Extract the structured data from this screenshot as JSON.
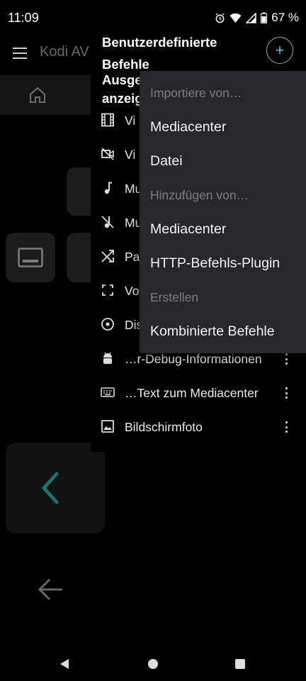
{
  "status_bar": {
    "time": "11:09",
    "battery": "67 %"
  },
  "background_app": {
    "title": "Kodi AV"
  },
  "drawer": {
    "title": "Benutzerdefinierte Befehle",
    "subtitle": "Ausgewählte anzeigen",
    "add_label": "+",
    "commands": [
      {
        "label": "Vi",
        "icon": "film-icon"
      },
      {
        "label": "Vi",
        "icon": "videocam-off-icon"
      },
      {
        "label": "Mu",
        "icon": "music-note-icon"
      },
      {
        "label": "Mu",
        "icon": "music-off-icon"
      },
      {
        "label": "Pa",
        "icon": "shuffle-icon"
      },
      {
        "label": "Vo",
        "icon": "fullscreen-icon"
      },
      {
        "label": "Dis",
        "icon": "disc-icon"
      },
      {
        "label": "…r-Debug-Informationen",
        "icon": "android-icon"
      },
      {
        "label": "…Text zum Mediacenter",
        "icon": "keyboard-icon"
      },
      {
        "label": "Bildschirmfoto",
        "icon": "image-icon"
      }
    ]
  },
  "popup_menu": {
    "import_header": "Importiere von…",
    "import_items": [
      "Mediacenter",
      "Datei"
    ],
    "add_header": "Hinzufügen von…",
    "add_items": [
      "Mediacenter",
      "HTTP-Befehls-Plugin"
    ],
    "create_header": "Erstellen",
    "create_items": [
      "Kombinierte Befehle"
    ]
  },
  "colors": {
    "accent": "#4fc7c0",
    "popup_bg": "#28282b",
    "header_text": "#7d7d80"
  }
}
